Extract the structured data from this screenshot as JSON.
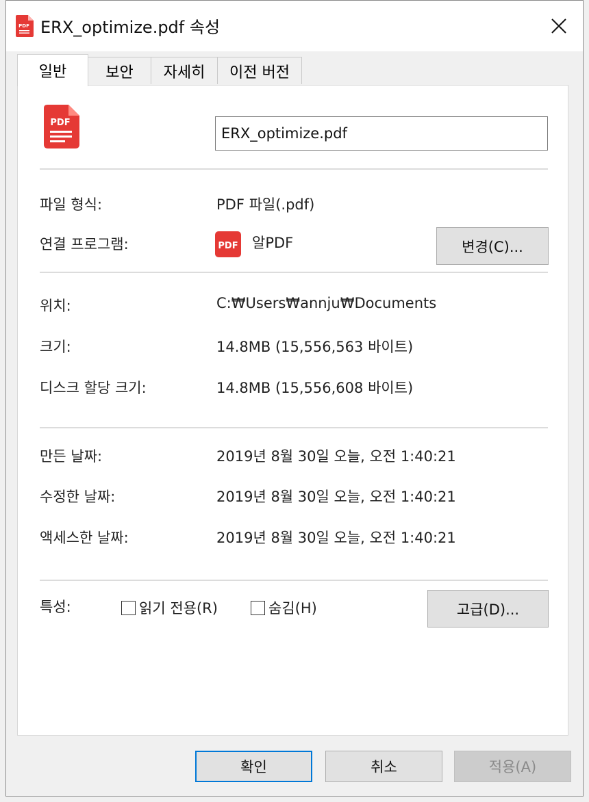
{
  "window": {
    "title": "ERX_optimize.pdf 속성"
  },
  "tabs": [
    {
      "label": "일반",
      "active": true
    },
    {
      "label": "보안",
      "active": false
    },
    {
      "label": "자세히",
      "active": false
    },
    {
      "label": "이전 버전",
      "active": false
    }
  ],
  "general": {
    "file_name": "ERX_optimize.pdf",
    "file_type": {
      "label": "파일 형식:",
      "value": "PDF 파일(.pdf)"
    },
    "opens_with": {
      "label": "연결 프로그램:",
      "app_name": "알PDF",
      "icon_text": "PDF",
      "change_button": "변경(C)..."
    },
    "location": {
      "label": "위치:",
      "value": "C:₩Users₩annju₩Documents"
    },
    "size": {
      "label": "크기:",
      "value": "14.8MB (15,556,563 바이트)"
    },
    "size_on_disk": {
      "label": "디스크 할당 크기:",
      "value": "14.8MB (15,556,608 바이트)"
    },
    "created": {
      "label": "만든 날짜:",
      "value": "2019년 8월 30일 오늘, 오전 1:40:21"
    },
    "modified": {
      "label": "수정한 날짜:",
      "value": "2019년 8월 30일 오늘, 오전 1:40:21"
    },
    "accessed": {
      "label": "액세스한 날짜:",
      "value": "2019년 8월 30일 오늘, 오전 1:40:21"
    },
    "attributes": {
      "label": "특성:",
      "readonly": {
        "label": "읽기 전용(R)",
        "checked": false
      },
      "hidden": {
        "label": "숨김(H)",
        "checked": false
      },
      "advanced_button": "고급(D)..."
    },
    "file_icon_text": "PDF"
  },
  "footer": {
    "ok": "확인",
    "cancel": "취소",
    "apply": "적용(A)"
  },
  "colors": {
    "pdf_red": "#e53935",
    "accent_blue": "#0078d7"
  }
}
